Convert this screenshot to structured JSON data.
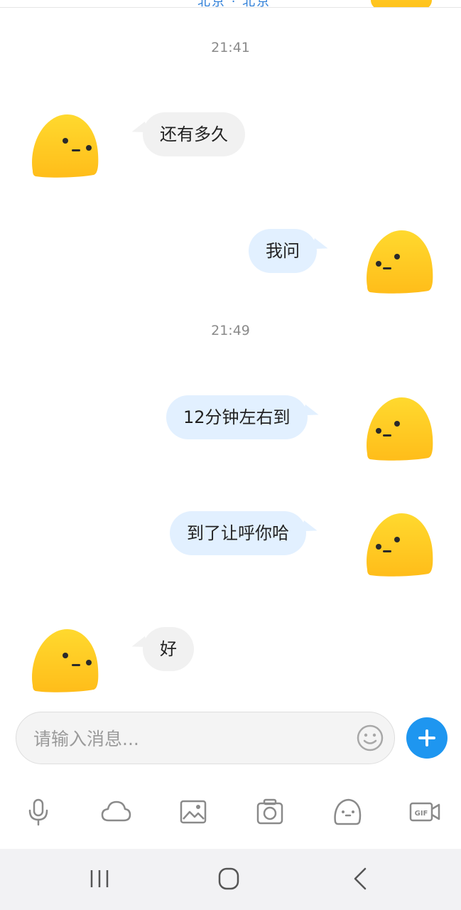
{
  "top_partial_text": "北京 · 北京",
  "messages": [
    {
      "type": "timestamp",
      "text": "21:41"
    },
    {
      "type": "incoming",
      "text": "还有多久"
    },
    {
      "type": "outgoing",
      "text": "我问"
    },
    {
      "type": "timestamp",
      "text": "21:49"
    },
    {
      "type": "outgoing",
      "text": "12分钟左右到"
    },
    {
      "type": "outgoing",
      "text": "到了让呼你哈"
    },
    {
      "type": "incoming",
      "text": "好"
    }
  ],
  "input": {
    "placeholder": "请输入消息...",
    "value": ""
  },
  "toolbar": {
    "icons": [
      "microphone-icon",
      "cloud-icon",
      "image-icon",
      "camera-icon",
      "emoji-icon",
      "gif-video-icon"
    ],
    "gif_label": "GIF"
  },
  "system_nav": [
    "recent-apps-icon",
    "home-icon",
    "back-icon"
  ],
  "colors": {
    "avatar_yellow": "#ffc81e",
    "incoming_bubble": "#f1f1f1",
    "outgoing_bubble": "#e2f0ff",
    "accent_blue": "#1e96f0",
    "timestamp_gray": "#8a8a8a"
  }
}
